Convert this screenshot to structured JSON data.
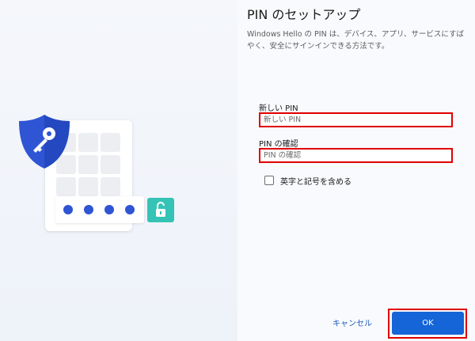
{
  "page": {
    "title": "PIN のセットアップ",
    "description": "Windows Hello の PIN は、デバイス、アプリ、サービスにすばやく、安全にサインインできる方法です。"
  },
  "form": {
    "new_pin": {
      "label": "新しい PIN",
      "placeholder": "新しい PIN"
    },
    "confirm_pin": {
      "label": "PIN の確認",
      "placeholder": "PIN の確認"
    },
    "include_letters": {
      "label": "英字と記号を含める",
      "checked": false
    }
  },
  "buttons": {
    "cancel": "キャンセル",
    "ok": "OK"
  },
  "illustration": {
    "shield_icon": "shield-key-icon",
    "lock_icon": "unlocked-padlock-icon",
    "pin_dots": 4,
    "colors": {
      "shield": "#2f55d4",
      "dots": "#2f55d4",
      "lock_badge": "#35c3b5",
      "highlight": "#e00000",
      "ok": "#1565d8"
    }
  }
}
